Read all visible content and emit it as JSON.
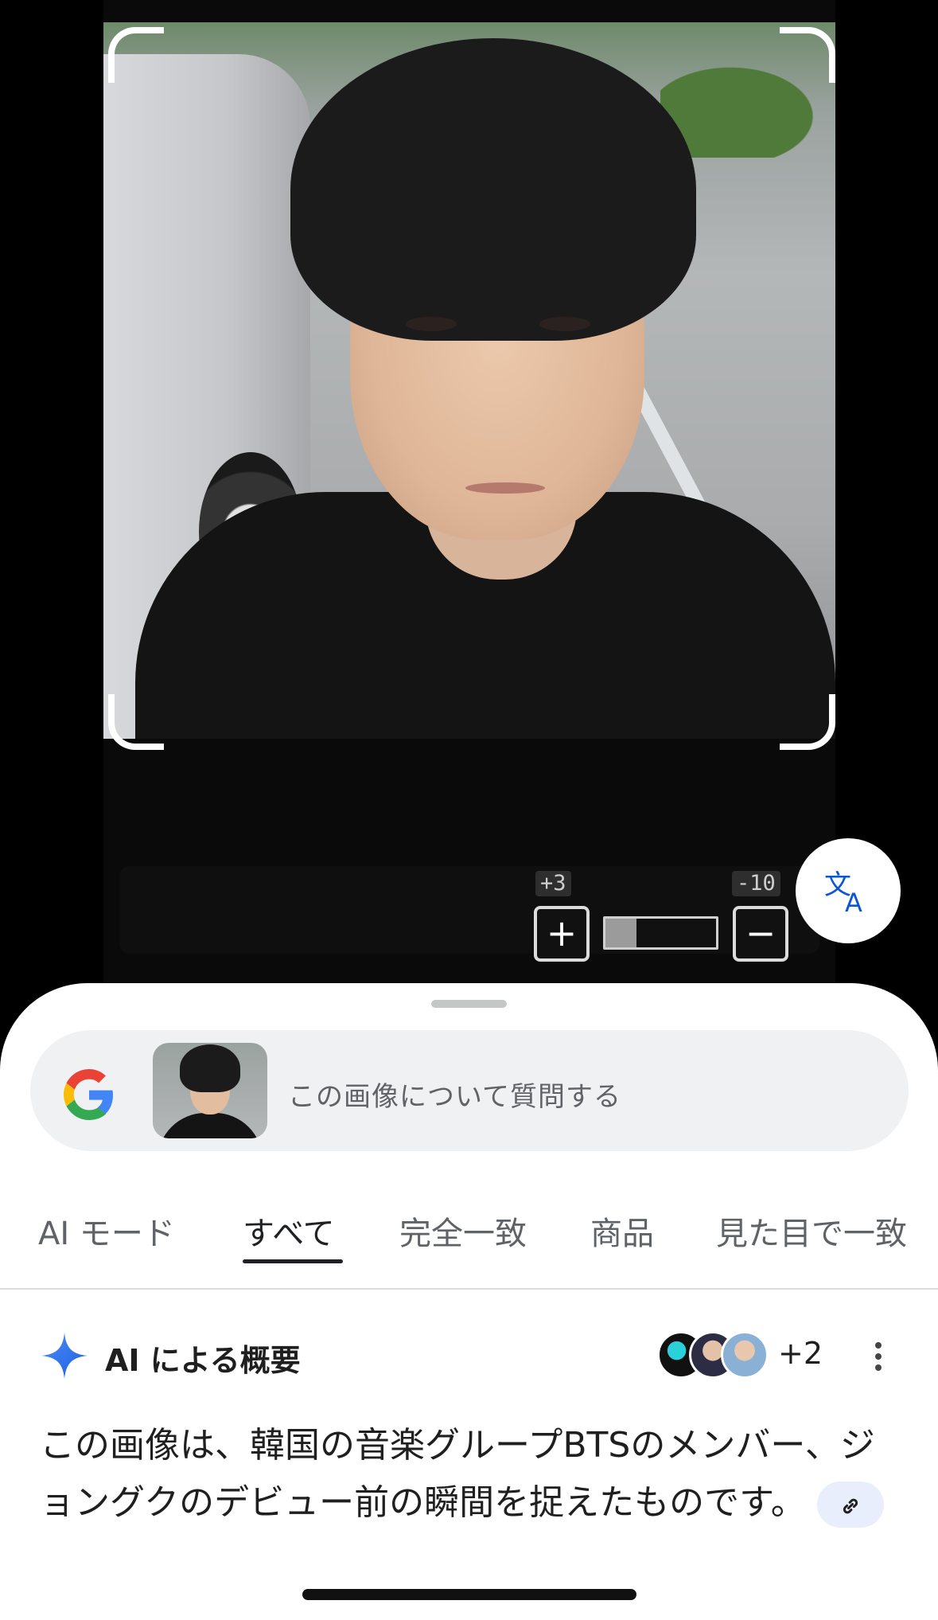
{
  "viewer": {
    "zoom_in_step": "+3",
    "zoom_out_step": "-10",
    "zoom_level": 0.28
  },
  "search": {
    "placeholder": "この画像について質問する"
  },
  "tabs": [
    {
      "label": "AI モード"
    },
    {
      "label": "すべて",
      "active": true
    },
    {
      "label": "完全一致"
    },
    {
      "label": "商品"
    },
    {
      "label": "見た目で一致"
    }
  ],
  "ai_overview": {
    "title": "AI による概要",
    "sources_more": "+2",
    "body": "この画像は、韓国の音楽グループBTSのメンバー、ジョングクのデビュー前の瞬間を捉えたものです。"
  },
  "colors": {
    "accent_blue": "#0b57d0",
    "sheet_bg": "#ffffff",
    "search_bg": "#f0f1f3"
  },
  "icons": [
    "translate-icon",
    "google-g-icon",
    "sparkle-icon",
    "link-icon",
    "more-vert-icon"
  ]
}
